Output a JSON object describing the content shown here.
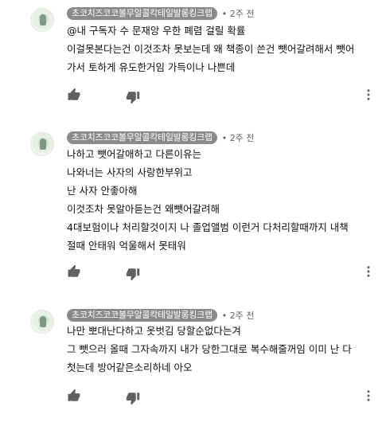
{
  "comments": [
    {
      "author": "초코치즈코코볼무알콜칵테일발롱킹크랩",
      "time": "2주 전",
      "lines": [
        "@내 구독자 수 문재앙 우한 폐렴 걸릴 확률",
        "이걸못본다는건 이것조차 못보는데 왜 책종이 쓴건 뺏어갈려해서 뺏어",
        "가서 토하게 유도한거임 가득이나 나쁜데"
      ]
    },
    {
      "author": "초코치즈코코볼무알콜칵테일발롱킹크랩",
      "time": "2주 전",
      "lines": [
        "나하고 뺏어갈애하고 다른이유는",
        "나와너는 사자의 사랑한부위고",
        "난 사자 안좋아해",
        "이것조차 못알아듣는건 왜뺏어갈려해",
        "4대보험이나 처리할것이지 나 졸업앨범 이런거 다처리할때까지 내책",
        "절때 안태워 억울해서 못태워"
      ]
    },
    {
      "author": "초코치즈코코볼무알콜칵테일발롱킹크랩",
      "time": "2주 전",
      "lines": [
        "나만 뽀대난다하고 옷벗김 당할순없다는겨",
        "그 뺏으러 올때 그자속까지 내가 당한그대로 복수해줄꺼임 이미 난 다",
        "첫는데 방어같은소리하네 아오"
      ]
    }
  ]
}
